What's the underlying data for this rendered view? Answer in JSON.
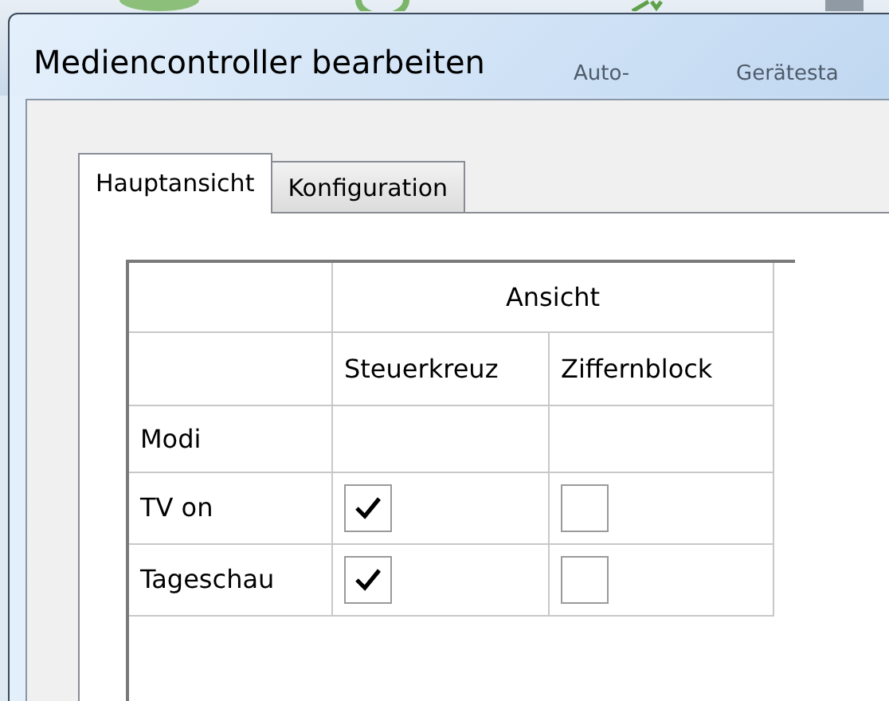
{
  "background_toolbar": [
    {
      "label": "Auto-"
    },
    {
      "label": "Gerätesta"
    }
  ],
  "window": {
    "title": "Mediencontroller bearbeiten"
  },
  "tabs": [
    {
      "label": "Hauptansicht",
      "selected": true
    },
    {
      "label": "Konfiguration",
      "selected": false
    }
  ],
  "table": {
    "group_header": "Ansicht",
    "columns": [
      "Steuerkreuz",
      "Ziffernblock"
    ],
    "rows": [
      {
        "label": "Modi"
      },
      {
        "label": "TV on",
        "checks": [
          true,
          false
        ]
      },
      {
        "label": "Tageschau",
        "checks": [
          true,
          false
        ]
      }
    ]
  }
}
